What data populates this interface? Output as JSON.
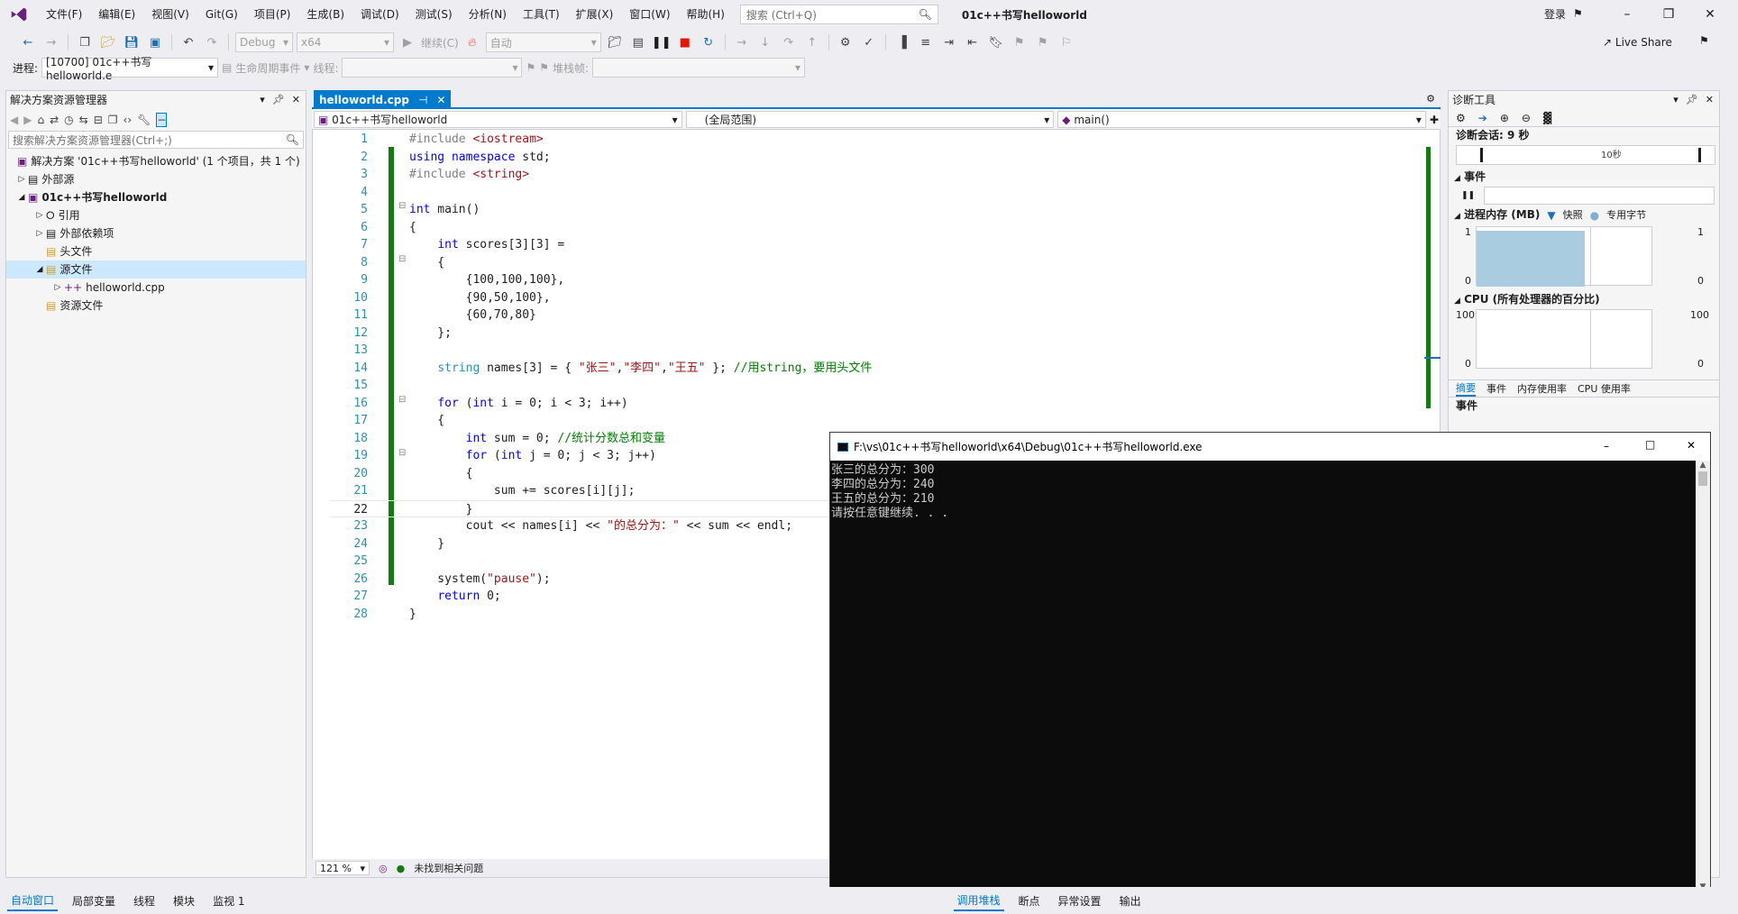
{
  "menubar": {
    "items": [
      "文件(F)",
      "编辑(E)",
      "视图(V)",
      "Git(G)",
      "项目(P)",
      "生成(B)",
      "调试(D)",
      "测试(S)",
      "分析(N)",
      "工具(T)",
      "扩展(X)",
      "窗口(W)",
      "帮助(H)"
    ],
    "search_placeholder": "搜索 (Ctrl+Q)",
    "solution_name": "01c++书写helloworld",
    "login": "登录"
  },
  "toolbar": {
    "config": "Debug",
    "platform": "x64",
    "continue": "继续(C)",
    "auto": "自动",
    "live_share": "Live Share",
    "process_label": "进程:",
    "process_value": "[10700] 01c++书写helloworld.e",
    "lifecycle": "生命周期事件",
    "thread_label": "线程:",
    "stackframe_label": "堆栈帧:"
  },
  "solution_explorer": {
    "title": "解决方案资源管理器",
    "search_placeholder": "搜索解决方案资源管理器(Ctrl+;)",
    "solution": "解决方案 '01c++书写helloworld' (1 个项目，共 1 个)",
    "items": [
      "外部源",
      "01c++书写helloworld",
      "引用",
      "外部依赖项",
      "头文件",
      "源文件",
      "helloworld.cpp",
      "资源文件"
    ]
  },
  "editor": {
    "tab": "helloworld.cpp",
    "nav_project": "01c++书写helloworld",
    "nav_scope": "(全局范围)",
    "nav_func": "main()",
    "zoom": "121 %",
    "status": "未找到相关问题"
  },
  "diagnostics": {
    "title": "诊断工具",
    "session": "诊断会话: 9 秒",
    "timeline_label": "10秒",
    "events": "事件",
    "memory": "进程内存 (MB)",
    "snapshot": "快照",
    "private_bytes": "专用字节",
    "mem_max_left": "1",
    "mem_min_left": "0",
    "mem_max_right": "1",
    "mem_min_right": "0",
    "cpu": "CPU (所有处理器的百分比)",
    "cpu_max_left": "100",
    "cpu_min_left": "0",
    "cpu_max_right": "100",
    "cpu_min_right": "0",
    "tabs": [
      "摘要",
      "事件",
      "内存使用率",
      "CPU 使用率"
    ],
    "events_section": "事件"
  },
  "console": {
    "title": "F:\\vs\\01c++书写helloworld\\x64\\Debug\\01c++书写helloworld.exe",
    "lines": [
      "张三的总分为：300",
      "李四的总分为：240",
      "王五的总分为：210",
      "请按任意键继续. . ."
    ]
  },
  "bottom_tabs": {
    "left": [
      "自动窗口",
      "局部变量",
      "线程",
      "模块",
      "监视 1"
    ],
    "right": [
      "调用堆栈",
      "断点",
      "异常设置",
      "输出"
    ]
  },
  "colors": {
    "accent": "#007acc",
    "keyword": "#0000ff",
    "type": "#2b91af",
    "string": "#a31515",
    "comment": "#008000",
    "change_bar": "#107c10"
  }
}
